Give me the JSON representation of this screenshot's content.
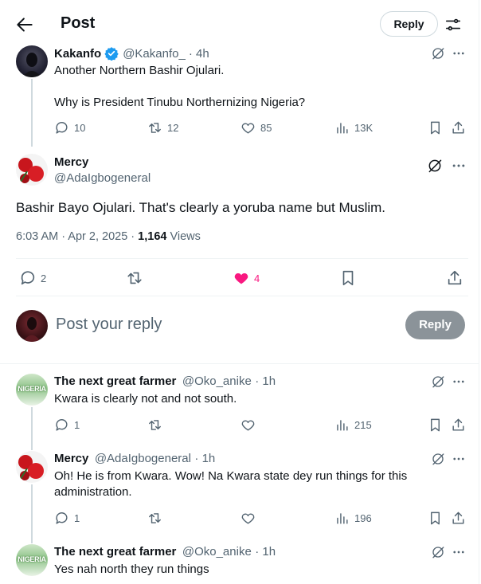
{
  "header": {
    "title": "Post",
    "reply_label": "Reply"
  },
  "parent": {
    "name": "Kakanfo",
    "handle": "@Kakanfo_",
    "time": "· 4h",
    "line1": "Another Northern Bashir Ojulari.",
    "line2": "Why is President Tinubu Northernizing Nigeria?",
    "replies": "10",
    "reposts": "12",
    "likes": "85",
    "views": "13K"
  },
  "main": {
    "name": "Mercy",
    "handle": "@AdaIgbogeneral",
    "text": "Bashir Bayo Ojulari. That's clearly a yoruba name but Muslim.",
    "time": "6:03 AM · Apr 2, 2025 · ",
    "views_count": "1,164",
    "views_label": " Views",
    "replies": "2",
    "likes": "4",
    "like_color": "#f91880"
  },
  "composer": {
    "placeholder": "Post your reply",
    "button": "Reply"
  },
  "replies": [
    {
      "name": "The next great farmer",
      "handle": "@Oko_anike",
      "time": "· 1h",
      "text": "Kwara is clearly not and not south.",
      "replies": "1",
      "views": "215",
      "avatar_text": "NIGERIA"
    },
    {
      "name": "Mercy",
      "handle": "@AdaIgbogeneral",
      "time": "· 1h",
      "text": "Oh! He is from Kwara. Wow! Na Kwara state dey run things for this administration.",
      "replies": "1",
      "views": "196"
    },
    {
      "name": "The next great farmer",
      "handle": "@Oko_anike",
      "time": "· 1h",
      "text": "Yes nah north they run things",
      "avatar_text": "NIGERIA"
    }
  ]
}
